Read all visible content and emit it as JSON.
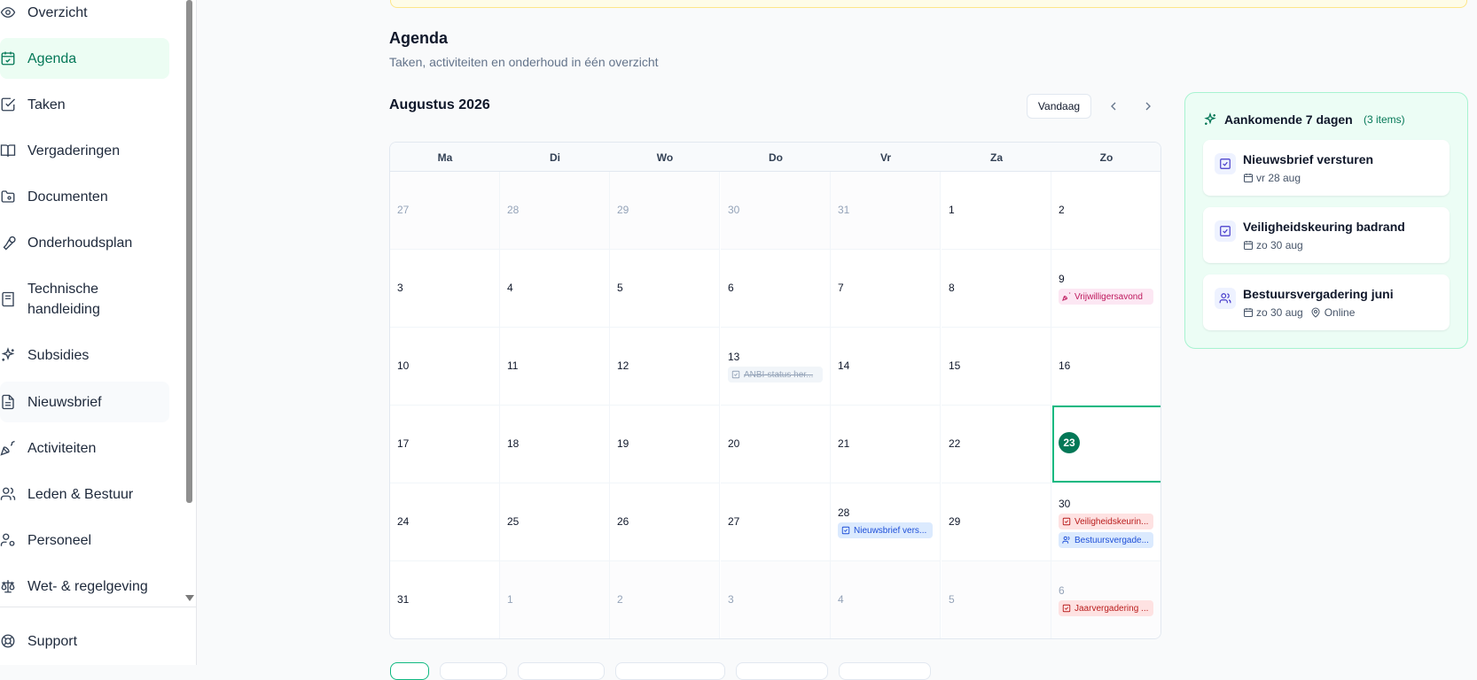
{
  "sidebar": {
    "items": [
      {
        "label": "Overzicht",
        "icon": "eye-icon"
      },
      {
        "label": "Agenda",
        "icon": "calendar-icon",
        "active": true
      },
      {
        "label": "Taken",
        "icon": "check-square-icon"
      },
      {
        "label": "Vergaderingen",
        "icon": "book-open-icon"
      },
      {
        "label": "Documenten",
        "icon": "folder-icon"
      },
      {
        "label": "Onderhoudsplan",
        "icon": "wrench-icon"
      },
      {
        "label": "Technische handleiding",
        "icon": "book-icon"
      },
      {
        "label": "Subsidies",
        "icon": "sparkles-icon"
      },
      {
        "label": "Nieuwsbrief",
        "icon": "file-text-icon"
      },
      {
        "label": "Activiteiten",
        "icon": "party-popper-icon"
      },
      {
        "label": "Leden & Bestuur",
        "icon": "users-icon"
      },
      {
        "label": "Personeel",
        "icon": "user-cog-icon"
      },
      {
        "label": "Wet- & regelgeving",
        "icon": "scale-icon"
      }
    ],
    "support": {
      "label": "Support",
      "icon": "life-buoy-icon"
    }
  },
  "page": {
    "title": "Agenda",
    "subtitle": "Taken, activiteiten en onderhoud in één overzicht"
  },
  "calendar": {
    "month_label": "Augustus 2026",
    "today_button": "Vandaag",
    "weekdays": [
      "Ma",
      "Di",
      "Wo",
      "Do",
      "Vr",
      "Za",
      "Zo"
    ],
    "weeks": [
      [
        "27",
        "28",
        "29",
        "30",
        "31",
        "1",
        "2"
      ],
      [
        "3",
        "4",
        "5",
        "6",
        "7",
        "8",
        "9"
      ],
      [
        "10",
        "11",
        "12",
        "13",
        "14",
        "15",
        "16"
      ],
      [
        "17",
        "18",
        "19",
        "20",
        "21",
        "22",
        "23"
      ],
      [
        "24",
        "25",
        "26",
        "27",
        "28",
        "29",
        "30"
      ],
      [
        "31",
        "1",
        "2",
        "3",
        "4",
        "5",
        "6"
      ]
    ],
    "events": {
      "vrijwilligersavond": "Vrijwilligersavond",
      "anbi": "ANBI-status her...",
      "nieuwsbrief": "Nieuwsbrief vers...",
      "veiligheid": "Veiligheidskeurin...",
      "bestuur": "Bestuursvergade...",
      "jaarvergadering": "Jaarvergadering ..."
    },
    "accent_color": "#047857"
  },
  "upcoming": {
    "title": "Aankomende 7 dagen",
    "count": "(3 items)",
    "items": [
      {
        "title": "Nieuwsbrief versturen",
        "date": "vr 28 aug",
        "location": ""
      },
      {
        "title": "Veiligheidskeuring badrand",
        "date": "zo 30 aug",
        "location": ""
      },
      {
        "title": "Bestuursvergadering juni",
        "date": "zo 30 aug",
        "location": "Online"
      }
    ]
  }
}
